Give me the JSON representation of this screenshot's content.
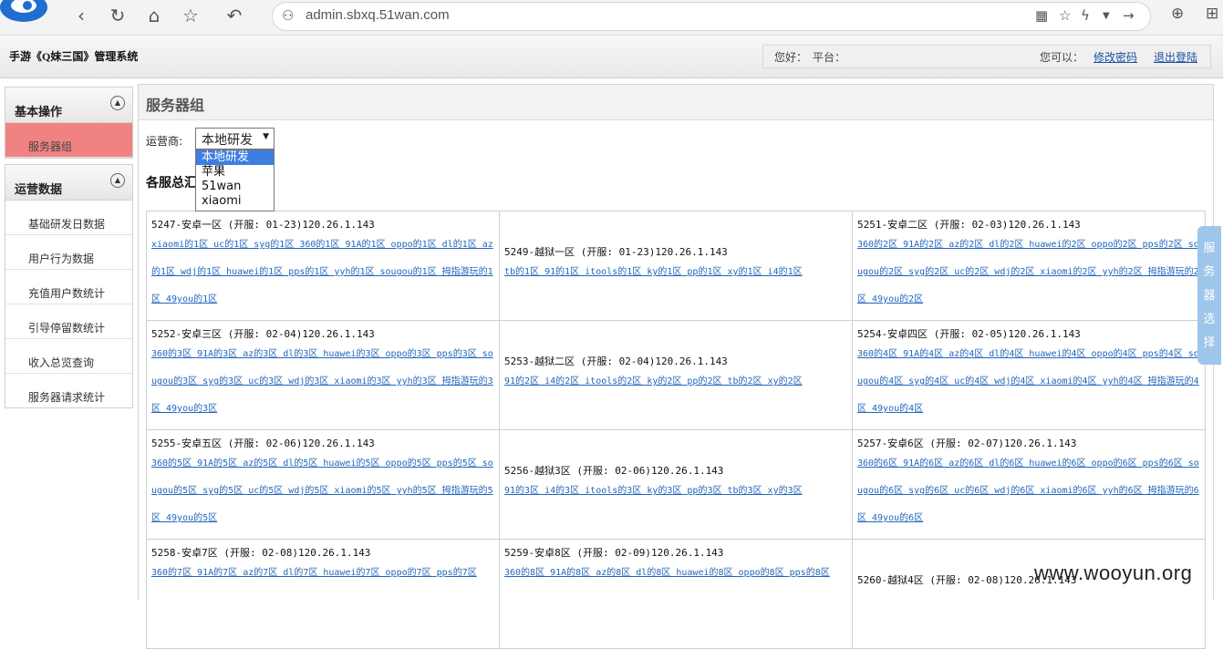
{
  "browser": {
    "url": "admin.sbxq.51wan.com",
    "back": "‹",
    "reload": "↻",
    "home": "⌂",
    "star": "☆",
    "undo": "↶"
  },
  "header": {
    "title": "手游《Q妹三国》管理系统",
    "greeting": "您好：",
    "platform": "平台：",
    "can_do": "您可以：",
    "change_password": "修改密码",
    "logout": "退出登陆"
  },
  "sidebar": {
    "groups": [
      {
        "title": "基本操作",
        "items": [
          "服务器组"
        ]
      },
      {
        "title": "运营数据",
        "items": [
          "基础研发日数据",
          "用户行为数据",
          "充值用户数统计",
          "引导停留数统计",
          "收入总览查询",
          "服务器请求统计"
        ]
      }
    ]
  },
  "main": {
    "title": "服务器组",
    "operator_label": "运营商:",
    "operator_selected": "本地研发",
    "operator_options": [
      "本地研发",
      "苹果",
      "51wan",
      "xiaomi"
    ],
    "summary_heading": "各服总汇"
  },
  "servers": [
    [
      {
        "name": "5247-安卓一区 (开服: 01-23)120.26.1.143",
        "links": "xiaomi的1区 uc的1区 syg的1区 360的1区 91A的1区 oppo的1区 dl的1区 az的1区 wdj的1区 huawei的1区 pps的1区 yyh的1区 sougou的1区 拇指游玩的1区 49you的1区 "
      },
      {
        "name": "5249-越狱一区 (开服: 01-23)120.26.1.143",
        "links": "tb的1区 91的1区 itools的1区 ky的1区 pp的1区 xy的1区 i4的1区 "
      },
      {
        "name": "5251-安卓二区 (开服: 02-03)120.26.1.143",
        "links": "360的2区 91A的2区 az的2区 dl的2区 huawei的2区 oppo的2区 pps的2区 sougou的2区 syg的2区 uc的2区 wdj的2区 xiaomi的2区 yyh的2区 拇指游玩的2区 49you的2区 "
      }
    ],
    [
      {
        "name": "5252-安卓三区 (开服: 02-04)120.26.1.143",
        "links": "360的3区 91A的3区 az的3区 dl的3区 huawei的3区 oppo的3区 pps的3区 sougou的3区 syg的3区 uc的3区 wdj的3区 xiaomi的3区 yyh的3区 拇指游玩的3区 49you的3区 "
      },
      {
        "name": "5253-越狱二区 (开服: 02-04)120.26.1.143",
        "links": "91的2区 i4的2区 itools的2区 ky的2区 pp的2区 tb的2区 xy的2区 "
      },
      {
        "name": "5254-安卓四区 (开服: 02-05)120.26.1.143",
        "links": "360的4区 91A的4区 az的4区 dl的4区 huawei的4区 oppo的4区 pps的4区 sougou的4区 syg的4区 uc的4区 wdj的4区 xiaomi的4区 yyh的4区 拇指游玩的4区 49you的4区 "
      }
    ],
    [
      {
        "name": "5255-安卓五区 (开服: 02-06)120.26.1.143",
        "links": "360的5区 91A的5区 az的5区 dl的5区 huawei的5区 oppo的5区 pps的5区 sougou的5区 syg的5区 uc的5区 wdj的5区 xiaomi的5区 yyh的5区 拇指游玩的5区 49you的5区 "
      },
      {
        "name": "5256-越狱3区 (开服: 02-06)120.26.1.143",
        "links": "91的3区 i4的3区 itools的3区 ky的3区 pp的3区 tb的3区 xy的3区 "
      },
      {
        "name": "5257-安卓6区 (开服: 02-07)120.26.1.143",
        "links": "360的6区 91A的6区 az的6区 dl的6区 huawei的6区 oppo的6区 pps的6区 sougou的6区 syg的6区 uc的6区 wdj的6区 xiaomi的6区 yyh的6区 拇指游玩的6区 49you的6区 "
      }
    ],
    [
      {
        "name": "5258-安卓7区 (开服: 02-08)120.26.1.143",
        "links": "360的7区 91A的7区 az的7区 dl的7区 huawei的7区 oppo的7区 pps的7区"
      },
      {
        "name": "5259-安卓8区 (开服: 02-09)120.26.1.143",
        "links": "360的8区 91A的8区 az的8区 dl的8区 huawei的8区 oppo的8区 pps的8区"
      },
      {
        "name": "5260-越狱4区 (开服: 02-08)120.26.1.143",
        "links": ""
      }
    ]
  ],
  "float_tab": "服务器选择",
  "watermark": "www.wooyun.org",
  "colors": {
    "active_menu": "#f08282",
    "link": "#2266bb",
    "float_tab": "#9dc6ea"
  }
}
